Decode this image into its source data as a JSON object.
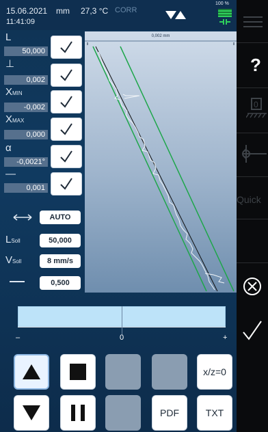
{
  "status": {
    "date": "15.06.2021",
    "time": "11:41:09",
    "unit": "mm",
    "temperature": "27,3 °C",
    "corr": "CORR",
    "battery": "100 %"
  },
  "params": [
    {
      "label": "L",
      "sub": "",
      "value": "50,000"
    },
    {
      "label": "⊥",
      "sub": "",
      "value": "0,002"
    },
    {
      "label": "X",
      "sub": "MIN",
      "value": "-0,002"
    },
    {
      "label": "X",
      "sub": "MAX",
      "value": "0,000"
    },
    {
      "label": "α",
      "sub": "",
      "value": "-0,0021°"
    },
    {
      "label": "—",
      "sub": "",
      "value": "0,001"
    }
  ],
  "chart": {
    "scale_label": "0,002 mm"
  },
  "settings": {
    "mode": "AUTO",
    "l_soll_label": "L",
    "l_soll_sub": "Soll",
    "l_soll_value": "50,000",
    "v_soll_label": "V",
    "v_soll_sub": "Soll",
    "v_soll_value": "8 mm/s",
    "tolerance_value": "0,500"
  },
  "deviation": {
    "minus": "–",
    "zero": "0",
    "plus": "+"
  },
  "controls": {
    "xz_label": "x/z=0",
    "pdf_label": "PDF",
    "txt_label": "TXT"
  },
  "sidebar": {
    "help": "?",
    "quick": "Quick"
  },
  "colors": {
    "background": "#103a60",
    "sidebar": "#0a0b0d",
    "tolerance_lines": "#1ea64a",
    "profile_line": "#f2f5f8",
    "deviation_bar": "#bde3f9"
  }
}
